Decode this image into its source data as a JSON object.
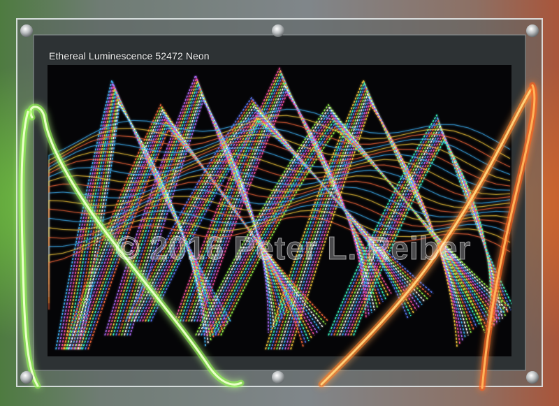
{
  "caption": "Ethereal Luminescence 52472 Neon",
  "watermark": "© 2016 Peter L. Reiber",
  "colors": {
    "neon_green": "#8dff3a",
    "neon_orange": "#ff7a1a",
    "frame_grey": "#7e8384",
    "panel_dark": "#2f3335"
  }
}
